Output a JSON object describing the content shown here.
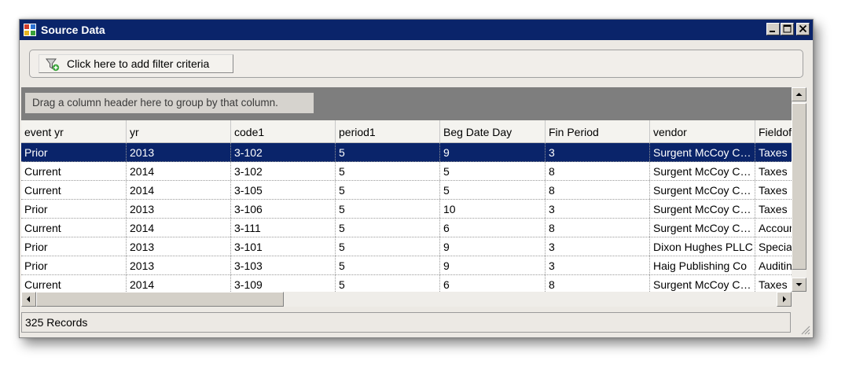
{
  "window": {
    "title": "Source Data",
    "accent_color": "#0a246a",
    "icons": [
      "app-icon",
      "minimize-icon",
      "maximize-icon",
      "close-icon"
    ]
  },
  "filter": {
    "button_label": "Click here to add filter criteria",
    "icon": "filter-add-icon"
  },
  "group_panel": {
    "hint": "Drag a column header here to group by that column."
  },
  "grid": {
    "columns": [
      "event yr",
      "yr",
      "code1",
      "period1",
      "Beg Date Day",
      "Fin Period",
      "vendor",
      "Fieldof"
    ],
    "rows": [
      [
        "Prior",
        "2013",
        "3-102",
        "5",
        "9",
        "3",
        "Surgent McCoy CPE",
        "Taxes"
      ],
      [
        "Current",
        "2014",
        "3-102",
        "5",
        "5",
        "8",
        "Surgent McCoy CPE",
        "Taxes"
      ],
      [
        "Current",
        "2014",
        "3-105",
        "5",
        "5",
        "8",
        "Surgent McCoy CPE",
        "Taxes"
      ],
      [
        "Prior",
        "2013",
        "3-106",
        "5",
        "10",
        "3",
        "Surgent McCoy CPE",
        "Taxes"
      ],
      [
        "Current",
        "2014",
        "3-111",
        "5",
        "6",
        "8",
        "Surgent McCoy CPE",
        "Accounting"
      ],
      [
        "Prior",
        "2013",
        "3-101",
        "5",
        "9",
        "3",
        "Dixon Hughes PLLC",
        "Specialized"
      ],
      [
        "Prior",
        "2013",
        "3-103",
        "5",
        "9",
        "3",
        "Haig Publishing Co",
        "Auditing"
      ],
      [
        "Current",
        "2014",
        "3-109",
        "5",
        "6",
        "8",
        "Surgent McCoy CPE",
        "Taxes"
      ]
    ],
    "selected_row": 0,
    "selection_color": "#0a246a"
  },
  "status": {
    "records": "325 Records"
  }
}
